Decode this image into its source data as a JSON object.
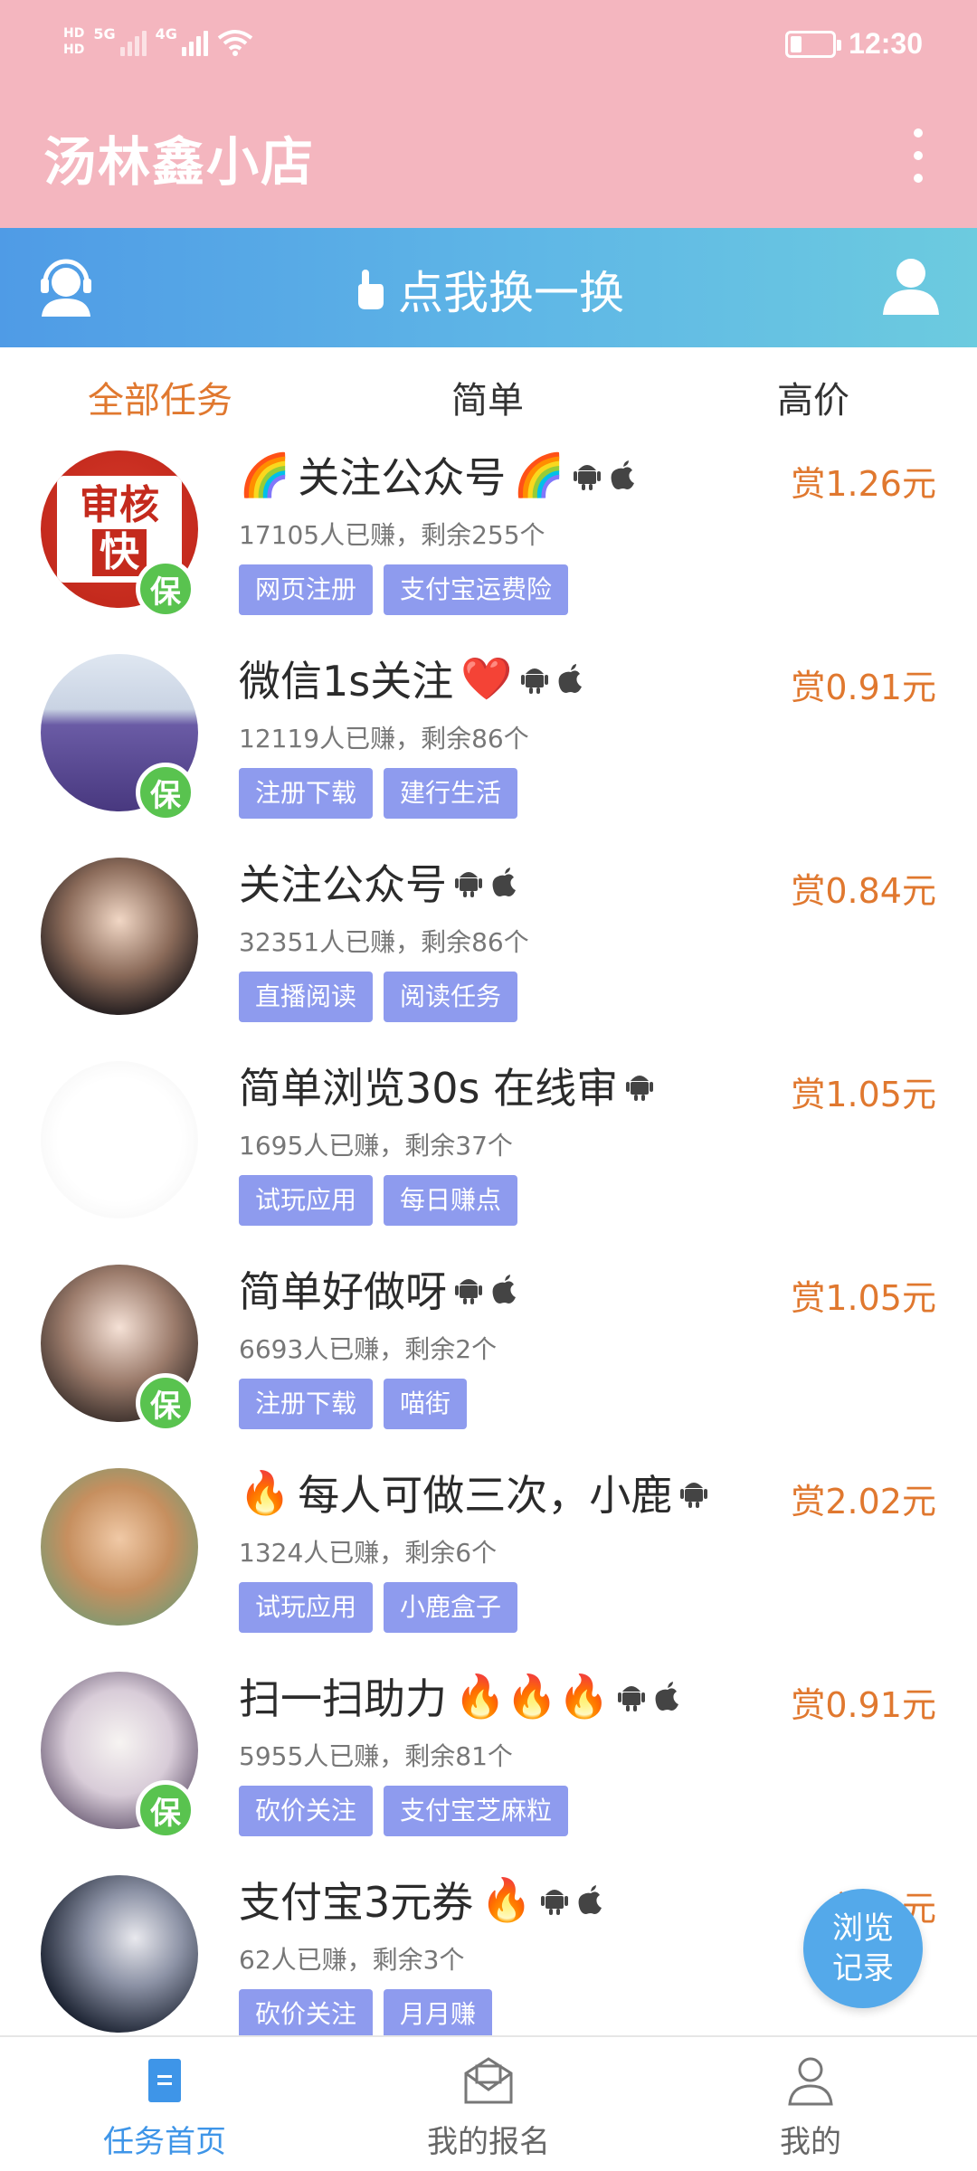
{
  "status_bar": {
    "hd1": "HD",
    "hd2": "HD",
    "sig1": "5G",
    "sig2": "4G",
    "time": "12:30"
  },
  "header": {
    "title": "汤林鑫小店"
  },
  "swap_bar": {
    "label": "点我换一换"
  },
  "tabs": [
    {
      "label": "全部任务",
      "active": true
    },
    {
      "label": "简单",
      "active": false
    },
    {
      "label": "高价",
      "active": false
    }
  ],
  "tasks": [
    {
      "prefix": "🌈",
      "title": "关注公众号",
      "suffix": "🌈",
      "android": true,
      "apple": true,
      "meta": "17105人已赚，剩余255个",
      "tags": [
        "网页注册",
        "支付宝运费险"
      ],
      "price": "赏1.26元",
      "guaranteed": true,
      "guarantee_label": "保",
      "avatar_text": [
        "审核",
        "快"
      ]
    },
    {
      "prefix": "",
      "title": "微信1s关注",
      "suffix": "❤️",
      "android": true,
      "apple": true,
      "meta": "12119人已赚，剩余86个",
      "tags": [
        "注册下载",
        "建行生活"
      ],
      "price": "赏0.91元",
      "guaranteed": true,
      "guarantee_label": "保"
    },
    {
      "prefix": "",
      "title": "关注公众号",
      "suffix": "",
      "android": true,
      "apple": true,
      "meta": "32351人已赚，剩余86个",
      "tags": [
        "直播阅读",
        "阅读任务"
      ],
      "price": "赏0.84元",
      "guaranteed": false
    },
    {
      "prefix": "",
      "title": "简单浏览30s 在线审",
      "suffix": "",
      "android": true,
      "apple": false,
      "meta": "1695人已赚，剩余37个",
      "tags": [
        "试玩应用",
        "每日赚点"
      ],
      "price": "赏1.05元",
      "guaranteed": false
    },
    {
      "prefix": "",
      "title": "简单好做呀",
      "suffix": "",
      "android": true,
      "apple": true,
      "meta": "6693人已赚，剩余2个",
      "tags": [
        "注册下载",
        "喵街"
      ],
      "price": "赏1.05元",
      "guaranteed": true,
      "guarantee_label": "保"
    },
    {
      "prefix": "🔥",
      "title": "每人可做三次，小鹿",
      "suffix": "",
      "android": true,
      "apple": false,
      "meta": "1324人已赚，剩余6个",
      "tags": [
        "试玩应用",
        "小鹿盒子"
      ],
      "price": "赏2.02元",
      "guaranteed": false
    },
    {
      "prefix": "",
      "title": "扫一扫助力",
      "suffix": "🔥🔥🔥",
      "android": true,
      "apple": true,
      "meta": "5955人已赚，剩余81个",
      "tags": [
        "砍价关注",
        "支付宝芝麻粒"
      ],
      "price": "赏0.91元",
      "guaranteed": true,
      "guarantee_label": "保"
    },
    {
      "prefix": "",
      "title": "支付宝3元券",
      "suffix": "🔥",
      "android": true,
      "apple": true,
      "meta": "62人已赚，剩余3个",
      "tags": [
        "砍价关注",
        "月月赚"
      ],
      "price": "赏…元",
      "guaranteed": false
    }
  ],
  "fab": {
    "line1": "浏览",
    "line2": "记录"
  },
  "bottom_nav": [
    {
      "label": "任务首页",
      "icon": "task-home-icon",
      "active": true
    },
    {
      "label": "我的报名",
      "icon": "envelope-icon",
      "active": false
    },
    {
      "label": "我的",
      "icon": "person-icon",
      "active": false
    }
  ],
  "colors": {
    "header": "#f4b6bf",
    "accent": "#e0782f",
    "tag": "#8e9bee",
    "nav_active": "#3e95e8",
    "guarantee": "#59c34f"
  }
}
